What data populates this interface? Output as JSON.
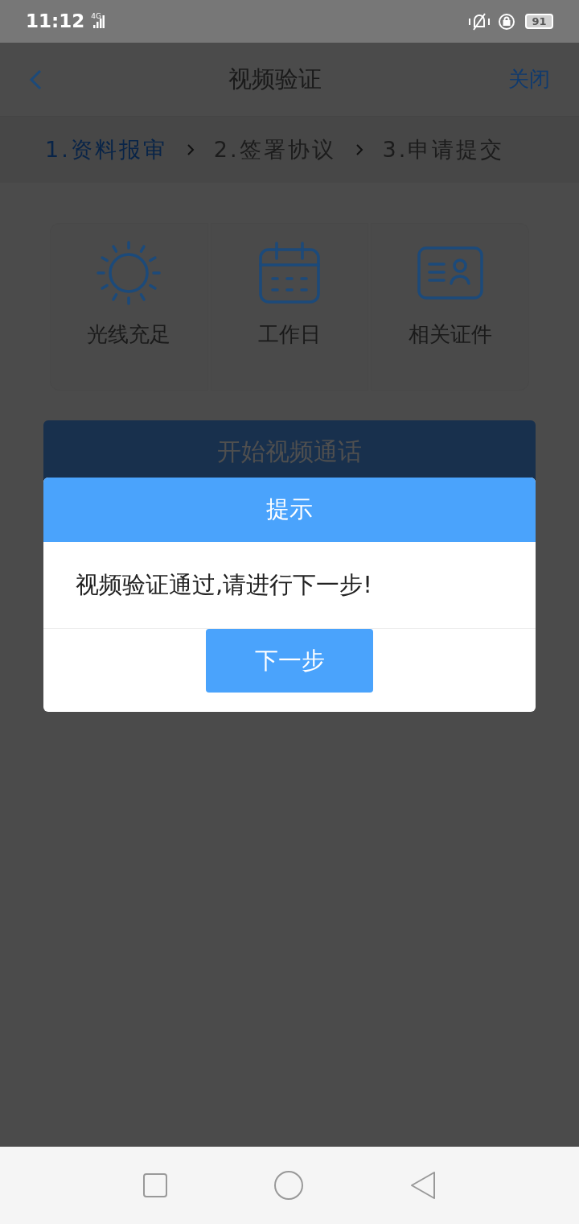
{
  "status_bar": {
    "time": "11:12",
    "network": "4G",
    "battery": "91"
  },
  "header": {
    "title": "视频验证",
    "close": "关闭"
  },
  "steps": [
    {
      "label": "1.资料报审",
      "selected": true
    },
    {
      "label": "2.签署协议",
      "selected": false
    },
    {
      "label": "3.申请提交",
      "selected": false
    }
  ],
  "requirements": [
    {
      "kind": "sun",
      "label": "光线充足"
    },
    {
      "kind": "calendar",
      "label": "工作日"
    },
    {
      "kind": "id",
      "label": "相关证件"
    }
  ],
  "start_button": "开始视频通话",
  "dialog": {
    "title": "提示",
    "message": "视频验证通过,请进行下一步!",
    "button": "下一步"
  }
}
